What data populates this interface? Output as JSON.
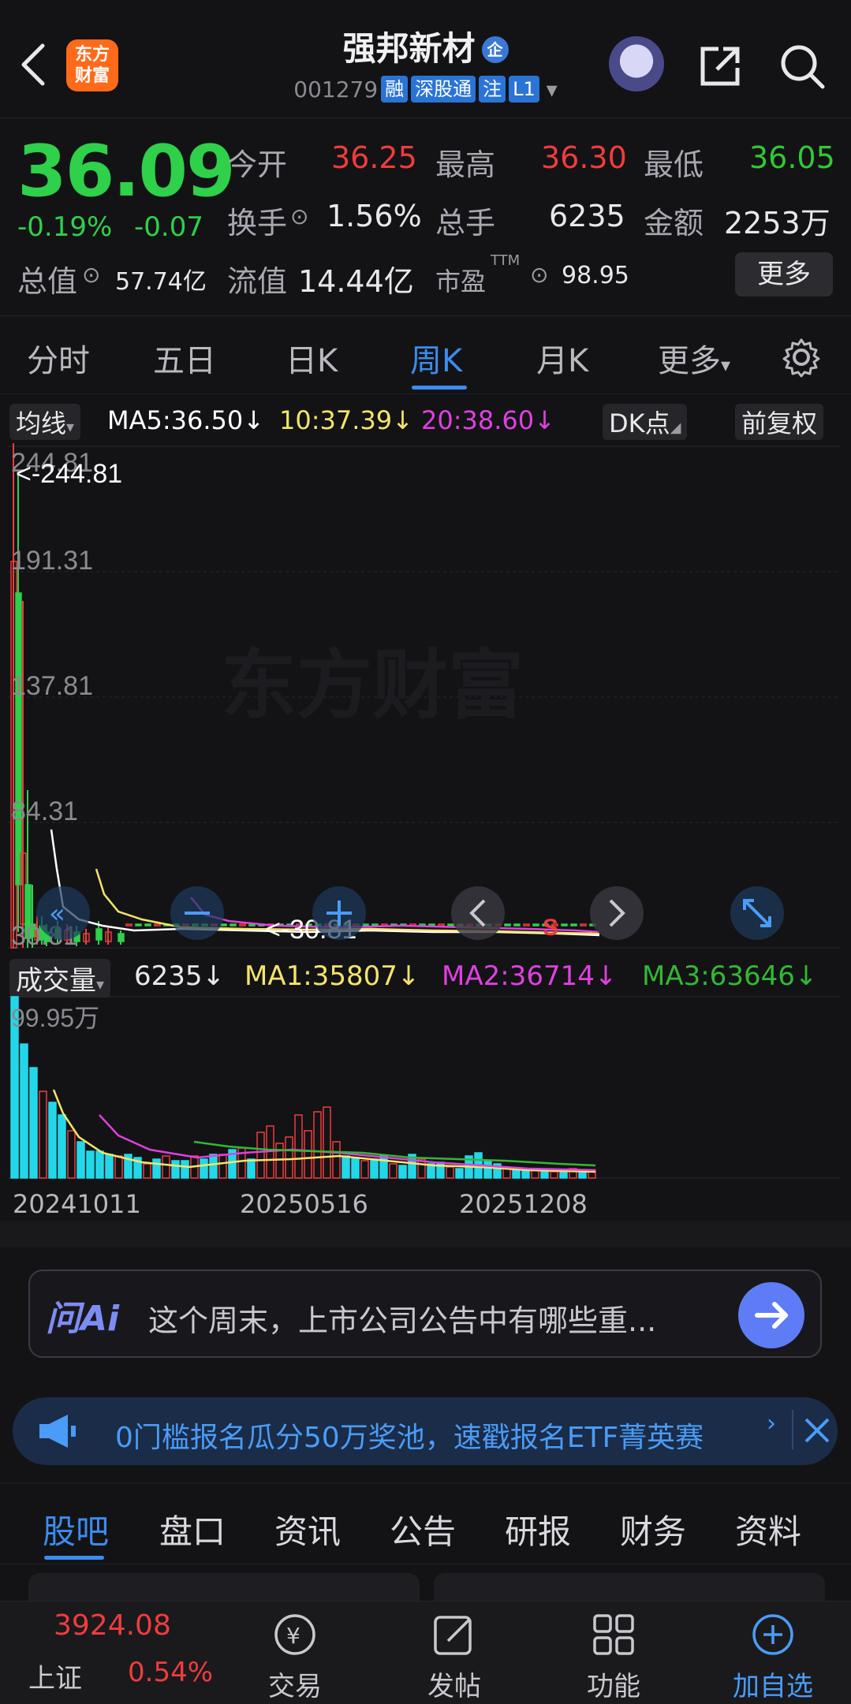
{
  "header": {
    "title": "强邦新材",
    "title_badge": "企",
    "code": "001279",
    "tags": [
      "融",
      "深股通",
      "注",
      "L1"
    ],
    "logo_text": "东方财富"
  },
  "quote": {
    "price": "36.09",
    "change_pct": "-0.19%",
    "change_abs": "-0.07",
    "open_label": "今开",
    "open": "36.25",
    "high_label": "最高",
    "high": "36.30",
    "low_label": "最低",
    "low": "36.05",
    "turnover_label": "换手",
    "turnover": "1.56%",
    "volume_label": "总手",
    "volume": "6235",
    "amount_label": "金额",
    "amount": "2253万",
    "mktcap_label": "总值",
    "mktcap": "57.74亿",
    "float_label": "流值",
    "float": "14.44亿",
    "pe_label": "市盈",
    "pe_sup": "TTM",
    "pe": "98.95",
    "more_label": "更多"
  },
  "period_tabs": [
    "分时",
    "五日",
    "日K",
    "周K",
    "月K",
    "更多"
  ],
  "active_period": "周K",
  "indicator": {
    "type": "均线",
    "ma5": "MA5:36.50↓",
    "ma10": "10:37.39↓",
    "ma20": "20:38.60↓",
    "dk": "DK点",
    "adjust": "前复权"
  },
  "volume_indicator": {
    "type": "成交量",
    "value": "6235↓",
    "ma1": "MA1:35807↓",
    "ma2": "MA2:36714↓",
    "ma3": "MA3:63646↓",
    "max_label": "99.95万"
  },
  "colors": {
    "up": "#f03c3c",
    "down": "#2fd04a",
    "accent": "#3c8cf0",
    "ma5": "#ffffff",
    "ma10": "#f5e46a",
    "ma20": "#e040e0",
    "ma3": "#33b833",
    "vol_bar": "#22d8e8"
  },
  "chart_data": {
    "type": "candlestick",
    "period": "weekly",
    "y_ticks": [
      "244.81",
      "191.31",
      "137.81",
      "84.31",
      "30.81"
    ],
    "ylim": [
      30.81,
      244.81
    ],
    "max_annotation": "<-244.81",
    "min_annotation": "<-30.81",
    "x_ticks": [
      "20241011",
      "20250516",
      "20251208"
    ],
    "watermark": "东方财富"
  },
  "ai": {
    "logo": "问Ai",
    "prompt": "这个周末，上市公司公告中有哪些重..."
  },
  "banner": {
    "text": "0门槛报名瓜分50万奖池，速戳报名ETF菁英赛"
  },
  "bottom_tabs": [
    "股吧",
    "盘口",
    "资讯",
    "公告",
    "研报",
    "财务",
    "资料"
  ],
  "active_bottom_tab": "股吧",
  "index": {
    "name": "上证",
    "value": "3924.08",
    "change": "0.54%"
  },
  "nav": [
    "交易",
    "发帖",
    "功能",
    "加自选"
  ]
}
